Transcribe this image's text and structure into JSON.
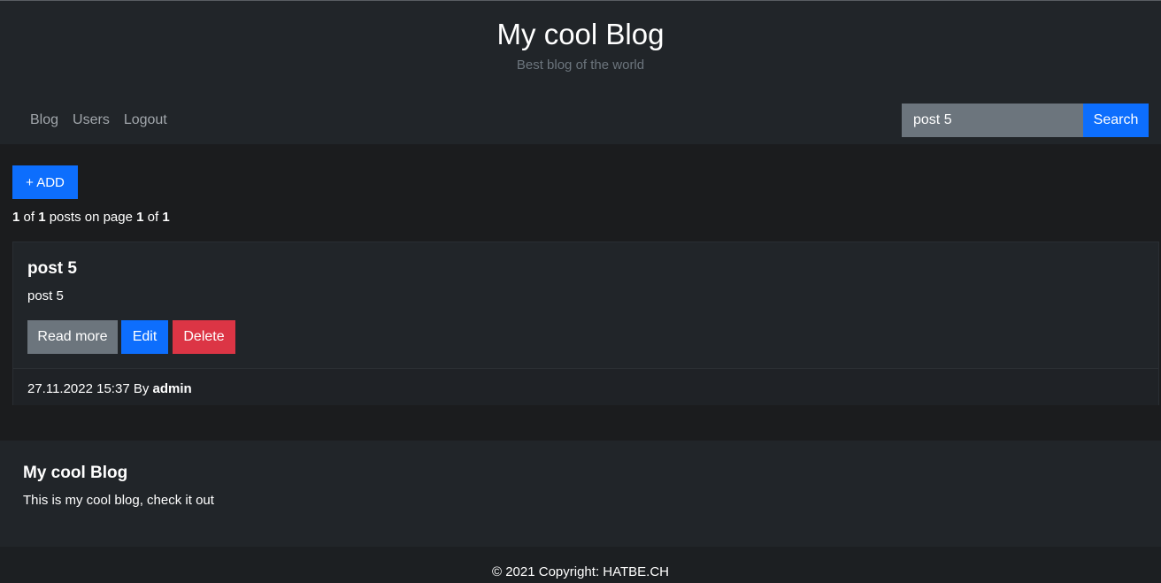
{
  "header": {
    "title": "My cool Blog",
    "subtitle": "Best blog of the world"
  },
  "nav": {
    "items": [
      {
        "label": "Blog"
      },
      {
        "label": "Users"
      },
      {
        "label": "Logout"
      }
    ]
  },
  "search": {
    "value": "post 5",
    "button_label": "Search"
  },
  "toolbar": {
    "add_label": "+ ADD"
  },
  "pagination": {
    "shown": "1",
    "total": "1",
    "text_posts_on_page": " posts on page ",
    "text_of": " of ",
    "page": "1",
    "pages": "1"
  },
  "posts": [
    {
      "title": "post 5",
      "excerpt": "post 5",
      "read_more_label": "Read more",
      "edit_label": "Edit",
      "delete_label": "Delete",
      "date": "27.11.2022 15:37",
      "by_label": "By",
      "author": "admin"
    }
  ],
  "footer": {
    "title": "My cool Blog",
    "text": "This is my cool blog, check it out",
    "copyright": "© 2021 Copyright: HATBE.CH"
  },
  "colors": {
    "primary": "#0d6efd",
    "secondary": "#6c757d",
    "danger": "#dc3545",
    "surface": "#212529",
    "background": "#1b1c1e"
  }
}
